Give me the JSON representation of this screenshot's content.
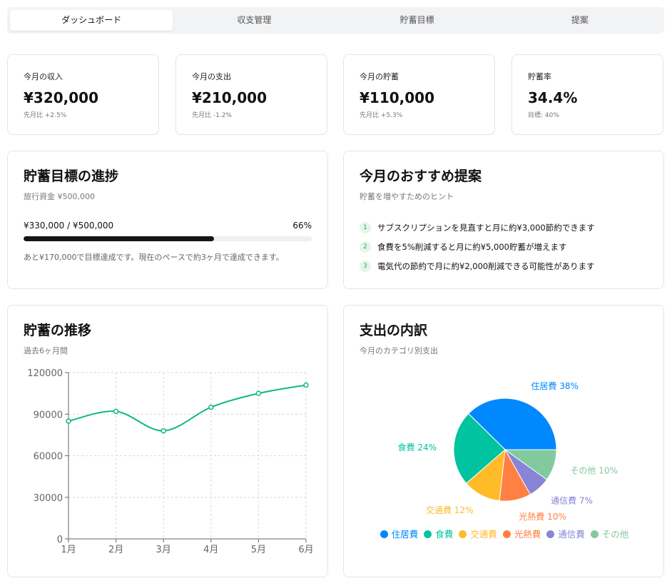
{
  "tabs": [
    {
      "label": "ダッシュボード",
      "active": true
    },
    {
      "label": "収支管理",
      "active": false
    },
    {
      "label": "貯蓄目標",
      "active": false
    },
    {
      "label": "提案",
      "active": false
    }
  ],
  "stats": [
    {
      "label": "今月の収入",
      "value": "¥320,000",
      "sub": "先月比 +2.5%"
    },
    {
      "label": "今月の支出",
      "value": "¥210,000",
      "sub": "先月比 -1.2%"
    },
    {
      "label": "今月の貯蓄",
      "value": "¥110,000",
      "sub": "先月比 +5.3%"
    },
    {
      "label": "貯蓄率",
      "value": "34.4%",
      "sub": "目標: 40%"
    }
  ],
  "goal": {
    "title": "貯蓄目標の進捗",
    "subtitle": "旅行資金 ¥500,000",
    "amount": "¥330,000 / ¥500,000",
    "percent_label": "66%",
    "progress": 0.66,
    "note": "あと¥170,000で目標達成です。現在のペースで約3ヶ月で達成できます。"
  },
  "tips": {
    "title": "今月のおすすめ提案",
    "subtitle": "貯蓄を増やすためのヒント",
    "items": [
      {
        "num": "1",
        "text": "サブスクリプションを見直すと月に約¥3,000節約できます"
      },
      {
        "num": "2",
        "text": "食費を5%削減すると月に約¥5,000貯蓄が増えます"
      },
      {
        "num": "3",
        "text": "電気代の節約で月に約¥2,000削減できる可能性があります"
      }
    ]
  },
  "trend": {
    "title": "貯蓄の推移",
    "subtitle": "過去6ヶ月間"
  },
  "breakdown": {
    "title": "支出の内訳",
    "subtitle": "今月のカテゴリ別支出"
  },
  "chart_data": [
    {
      "type": "line",
      "x": [
        "1月",
        "2月",
        "3月",
        "4月",
        "5月",
        "6月"
      ],
      "series": [
        {
          "values": [
            85000,
            92000,
            78000,
            95000,
            105000,
            111000
          ]
        }
      ],
      "yticks": [
        "0",
        "30000",
        "60000",
        "90000",
        "120000"
      ],
      "ylim": [
        0,
        120000
      ],
      "grid": true,
      "color": "#10b981"
    },
    {
      "type": "pie",
      "categories": [
        "住居費",
        "食費",
        "交通費",
        "光熱費",
        "通信費",
        "その他"
      ],
      "values": [
        38,
        24,
        12,
        10,
        7,
        10
      ],
      "slice_labels": [
        "住居費 38%",
        "食費 24%",
        "交通費 12%",
        "光熱費 10%",
        "通信費 7%",
        "その他 10%"
      ],
      "colors": [
        "#0088fe",
        "#00c49f",
        "#ffbb28",
        "#ff8042",
        "#8884d8",
        "#82ca9d"
      ],
      "legend": "bottom"
    }
  ]
}
